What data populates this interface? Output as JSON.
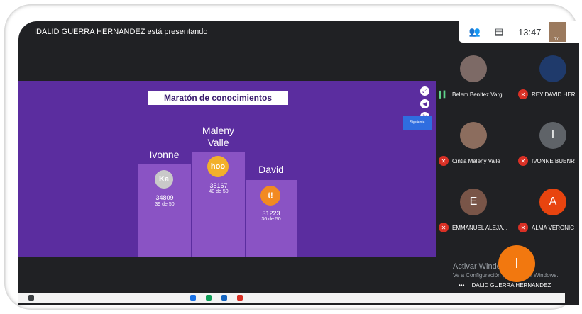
{
  "meet": {
    "presenting_banner": "IDALID GUERRA HERNANDEZ está presentando",
    "time": "13:47",
    "self_label": "Tú",
    "icons": {
      "people": "people-icon",
      "chat": "chat-icon"
    }
  },
  "slide": {
    "title": "Maratón de conocimientos",
    "next_label": "Siguiente",
    "podium": [
      {
        "name": "Ivonne",
        "badge": "Ka",
        "score": "34809",
        "detail": "39 de 50",
        "color": "#c9c9c9"
      },
      {
        "name": "Maleny Valle",
        "badge": "hoo",
        "score": "35167",
        "detail": "40 de 50",
        "color": "#f2b02a"
      },
      {
        "name": "David",
        "badge": "t!",
        "score": "31223",
        "detail": "36 de 50",
        "color": "#f28a22"
      }
    ]
  },
  "participants": [
    {
      "name": "Belem Benítez Varg...",
      "initial": "",
      "color": "#7d6a66",
      "status": "speaking"
    },
    {
      "name": "REY DAVID HER",
      "initial": "",
      "color": "#1f3a6b",
      "status": "muted"
    },
    {
      "name": "Cintia Maleny Valle",
      "initial": "",
      "color": "#8c6d5e",
      "status": "muted"
    },
    {
      "name": "IVONNE BUENR",
      "initial": "I",
      "color": "#5f6368",
      "status": "muted"
    },
    {
      "name": "EMMANUEL ALEJA...",
      "initial": "E",
      "color": "#795548",
      "status": "muted"
    },
    {
      "name": "ALMA VERONIC",
      "initial": "A",
      "color": "#e8440f",
      "status": "muted"
    }
  ],
  "activate_windows": {
    "line1": "Activar Windows",
    "line2": "Ve a Configuración para activar Windows."
  },
  "presenter": {
    "initial": "I",
    "name": "IDALID GUERRA HERNANDEZ"
  }
}
